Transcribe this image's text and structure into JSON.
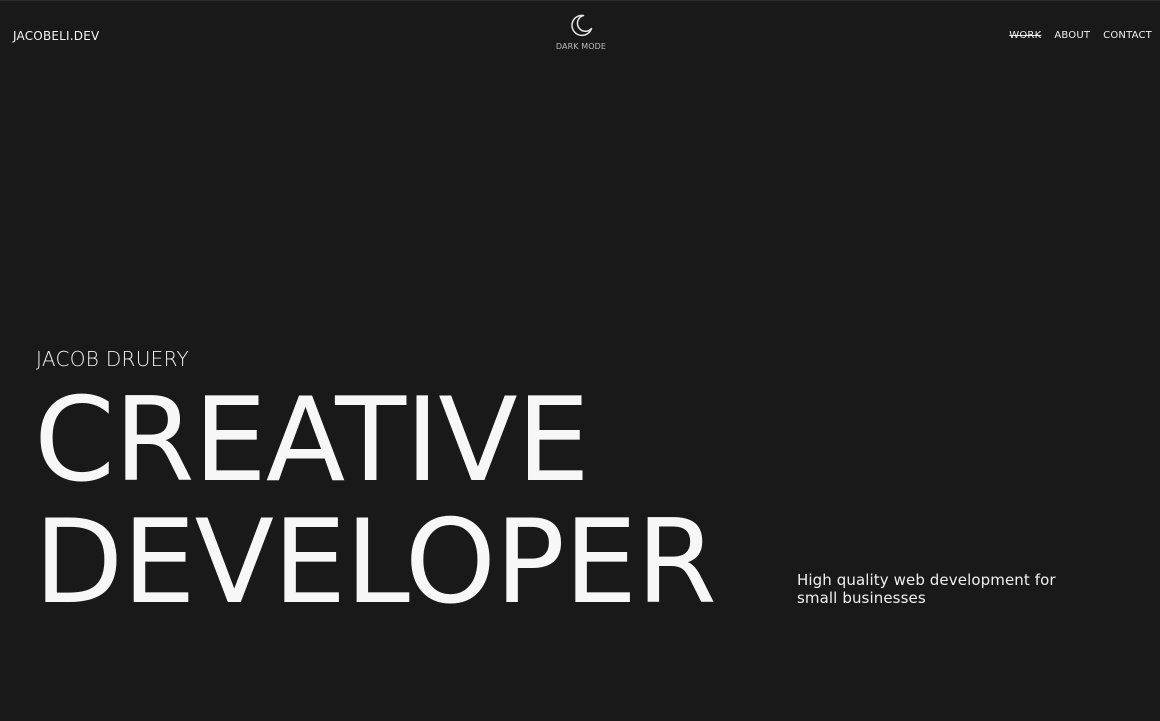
{
  "header": {
    "logo": "JACOBELI.DEV",
    "mode_toggle": {
      "icon": "moon-icon",
      "label": "DARK MODE"
    },
    "nav": [
      {
        "label": "WORK",
        "active": true
      },
      {
        "label": "ABOUT",
        "active": false
      },
      {
        "label": "CONTACT",
        "active": false
      }
    ]
  },
  "hero": {
    "name": "JACOB DRUERY",
    "headline_line1": "CREATIVE",
    "headline_line2": "DEVELOPER",
    "tagline": "High quality web development for small businesses"
  },
  "colors": {
    "background": "#191919",
    "text": "#f2f2f2"
  }
}
